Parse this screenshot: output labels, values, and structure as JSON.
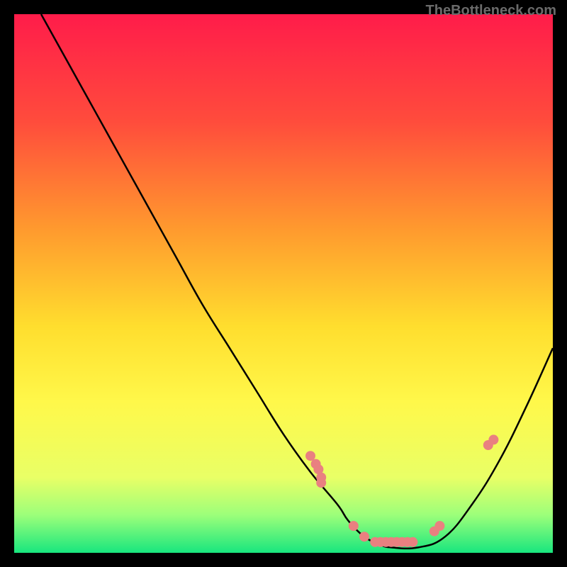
{
  "watermark": "TheBottleneck.com",
  "chart_data": {
    "type": "line",
    "title": "",
    "xlabel": "",
    "ylabel": "",
    "xlim": [
      0,
      100
    ],
    "ylim": [
      0,
      100
    ],
    "curve": {
      "name": "bottleneck-curve",
      "x": [
        5,
        10,
        15,
        20,
        25,
        30,
        35,
        40,
        45,
        50,
        55,
        60,
        62,
        65,
        68,
        70,
        75,
        80,
        85,
        90,
        95,
        100
      ],
      "y": [
        100,
        91,
        82,
        73,
        64,
        55,
        46,
        38,
        30,
        22,
        15,
        9,
        6,
        3,
        1.5,
        1,
        1,
        3,
        9,
        17,
        27,
        38
      ]
    },
    "markers": {
      "name": "data-points",
      "color": "#E98080",
      "x": [
        55,
        56,
        56.5,
        57,
        57,
        63,
        65,
        67,
        68,
        69,
        70,
        71,
        72,
        73,
        74,
        78,
        79,
        88,
        89
      ],
      "y": [
        18,
        16.5,
        15.5,
        14,
        13,
        5,
        3,
        2,
        2,
        2,
        2,
        2,
        2,
        2,
        2,
        4,
        5,
        20,
        21
      ]
    },
    "gradient_stops": [
      {
        "offset": 0,
        "color": "#FF1C4A"
      },
      {
        "offset": 20,
        "color": "#FF4C3C"
      },
      {
        "offset": 40,
        "color": "#FF9A2E"
      },
      {
        "offset": 58,
        "color": "#FFDE2E"
      },
      {
        "offset": 72,
        "color": "#FFF84A"
      },
      {
        "offset": 86,
        "color": "#E9FF66"
      },
      {
        "offset": 93,
        "color": "#9CFF7A"
      },
      {
        "offset": 100,
        "color": "#18E67E"
      }
    ]
  }
}
